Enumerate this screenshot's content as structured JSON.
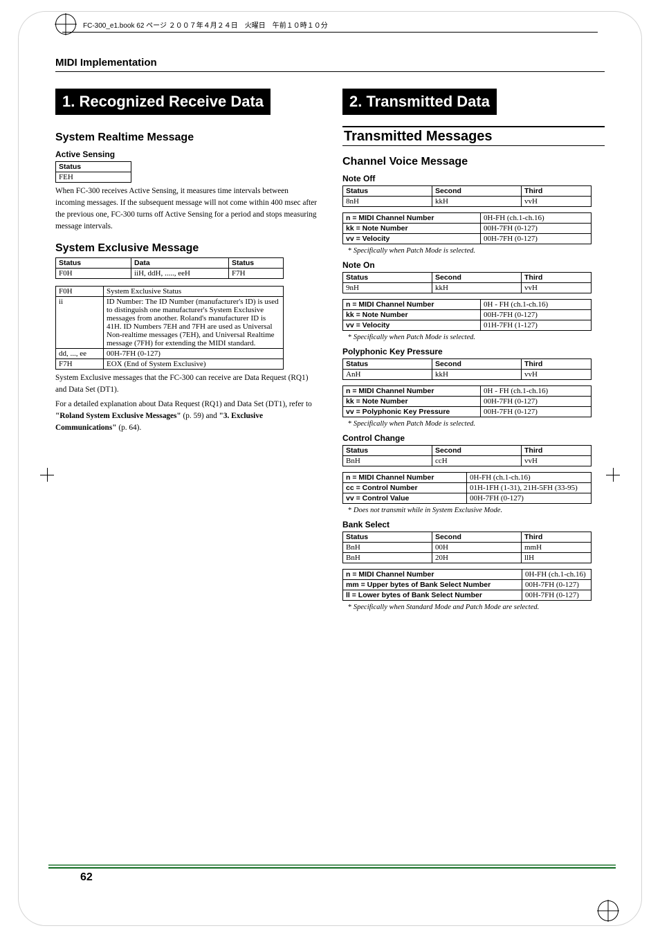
{
  "print_header": "FC-300_e1.book  62 ページ  ２００７年４月２４日　火曜日　午前１０時１０分",
  "page_title": "MIDI Implementation",
  "page_number": "62",
  "left": {
    "big_heading": "1. Recognized Receive Data",
    "h3_a": "System Realtime Message",
    "h4_a": "Active Sensing",
    "table_active_sensing": {
      "h1": "Status",
      "r1c1": "FEH"
    },
    "para_a": "When FC-300 receives Active Sensing, it measures time intervals between incoming messages. If the subsequent message will not come within 400 msec after the previous one, FC-300 turns off Active Sensing for a period and stops measuring message intervals.",
    "h3_b": "System Exclusive Message",
    "table_sx1": {
      "h1": "Status",
      "h2": "Data",
      "h3": "Status",
      "r1c1": "F0H",
      "r1c2": "iiH, ddH, ....., eeH",
      "r1c3": "F7H"
    },
    "table_sx2": {
      "r1c1": "F0H",
      "r1c2": "System Exclusive Status",
      "r2c1": "ii",
      "r2c2": "ID Number: The ID Number (manufacturer's ID) is used to distinguish one manufacturer's System Exclusive messages from another. Roland's manufacturer ID is 41H. ID Numbers 7EH and 7FH are used as Universal Non-realtime messages (7EH), and Universal Realtime message (7FH) for extending the MIDI standard.",
      "r3c1": "dd, ..., ee",
      "r3c2": "00H-7FH (0-127)",
      "r4c1": "F7H",
      "r4c2": "EOX (End of System Exclusive)"
    },
    "para_b": "System Exclusive messages that the FC-300 can receive are Data Request (RQ1) and Data Set (DT1).",
    "para_c_1": "For a detailed explanation about Data Request (RQ1) and Data Set (DT1), refer to ",
    "para_c_bold1": "\"Roland System Exclusive Messages\"",
    "para_c_2": " (p. 59) and ",
    "para_c_bold2": "\"3. Exclusive Communications\"",
    "para_c_3": " (p. 64)."
  },
  "right": {
    "big_heading": "2. Transmitted Data",
    "sub_heading": "Transmitted Messages",
    "h3_a": "Channel Voice Message",
    "note_off": {
      "h4": "Note Off",
      "t1": {
        "h1": "Status",
        "h2": "Second",
        "h3": "Third",
        "r1c1": "8nH",
        "r1c2": "kkH",
        "r1c3": "vvH"
      },
      "t2": {
        "r1c1": "n = MIDI Channel Number",
        "r1c2": "0H-FH (ch.1-ch.16)",
        "r2c1": "kk = Note Number",
        "r2c2": "00H-7FH (0-127)",
        "r3c1": "vv = Velocity",
        "r3c2": "00H-7FH (0-127)"
      },
      "note": "Specifically when Patch Mode is selected."
    },
    "note_on": {
      "h4": "Note On",
      "t1": {
        "h1": "Status",
        "h2": "Second",
        "h3": "Third",
        "r1c1": "9nH",
        "r1c2": "kkH",
        "r1c3": "vvH"
      },
      "t2": {
        "r1c1": "n = MIDI Channel Number",
        "r1c2": "0H - FH (ch.1-ch.16)",
        "r2c1": "kk = Note Number",
        "r2c2": "00H-7FH (0-127)",
        "r3c1": "vv = Velocity",
        "r3c2": "01H-7FH (1-127)"
      },
      "note": "Specifically when Patch Mode is selected."
    },
    "poly": {
      "h4": "Polyphonic Key Pressure",
      "t1": {
        "h1": "Status",
        "h2": "Second",
        "h3": "Third",
        "r1c1": "AnH",
        "r1c2": "kkH",
        "r1c3": "vvH"
      },
      "t2": {
        "r1c1": "n = MIDI Channel Number",
        "r1c2": "0H - FH (ch.1-ch.16)",
        "r2c1": "kk = Note Number",
        "r2c2": "00H-7FH (0-127)",
        "r3c1": "vv = Polyphonic Key Pressure",
        "r3c2": "00H-7FH (0-127)"
      },
      "note": "Specifically when Patch Mode is selected."
    },
    "cc": {
      "h4": "Control Change",
      "t1": {
        "h1": "Status",
        "h2": "Second",
        "h3": "Third",
        "r1c1": "BnH",
        "r1c2": "ccH",
        "r1c3": "vvH"
      },
      "t2": {
        "r1c1": "n = MIDI Channel Number",
        "r1c2": "0H-FH (ch.1-ch.16)",
        "r2c1": "cc = Control Number",
        "r2c2": "01H-1FH (1-31), 21H-5FH (33-95)",
        "r3c1": "vv = Control Value",
        "r3c2": "00H-7FH (0-127)"
      },
      "note": "Does not transmit while in System Exclusive Mode."
    },
    "bank": {
      "h4": "Bank Select",
      "t1": {
        "h1": "Status",
        "h2": "Second",
        "h3": "Third",
        "r1c1": "BnH",
        "r1c2": "00H",
        "r1c3": "mmH",
        "r2c1": "BnH",
        "r2c2": "20H",
        "r2c3": "llH"
      },
      "t2": {
        "r1c1": "n = MIDI Channel Number",
        "r1c2": "0H-FH (ch.1-ch.16)",
        "r2c1": "mm = Upper bytes of Bank Select Number",
        "r2c2": "00H-7FH (0-127)",
        "r3c1": "ll = Lower bytes of Bank Select Number",
        "r3c2": "00H-7FH (0-127)"
      },
      "note": "Specifically when Standard Mode and Patch Mode are selected."
    }
  }
}
